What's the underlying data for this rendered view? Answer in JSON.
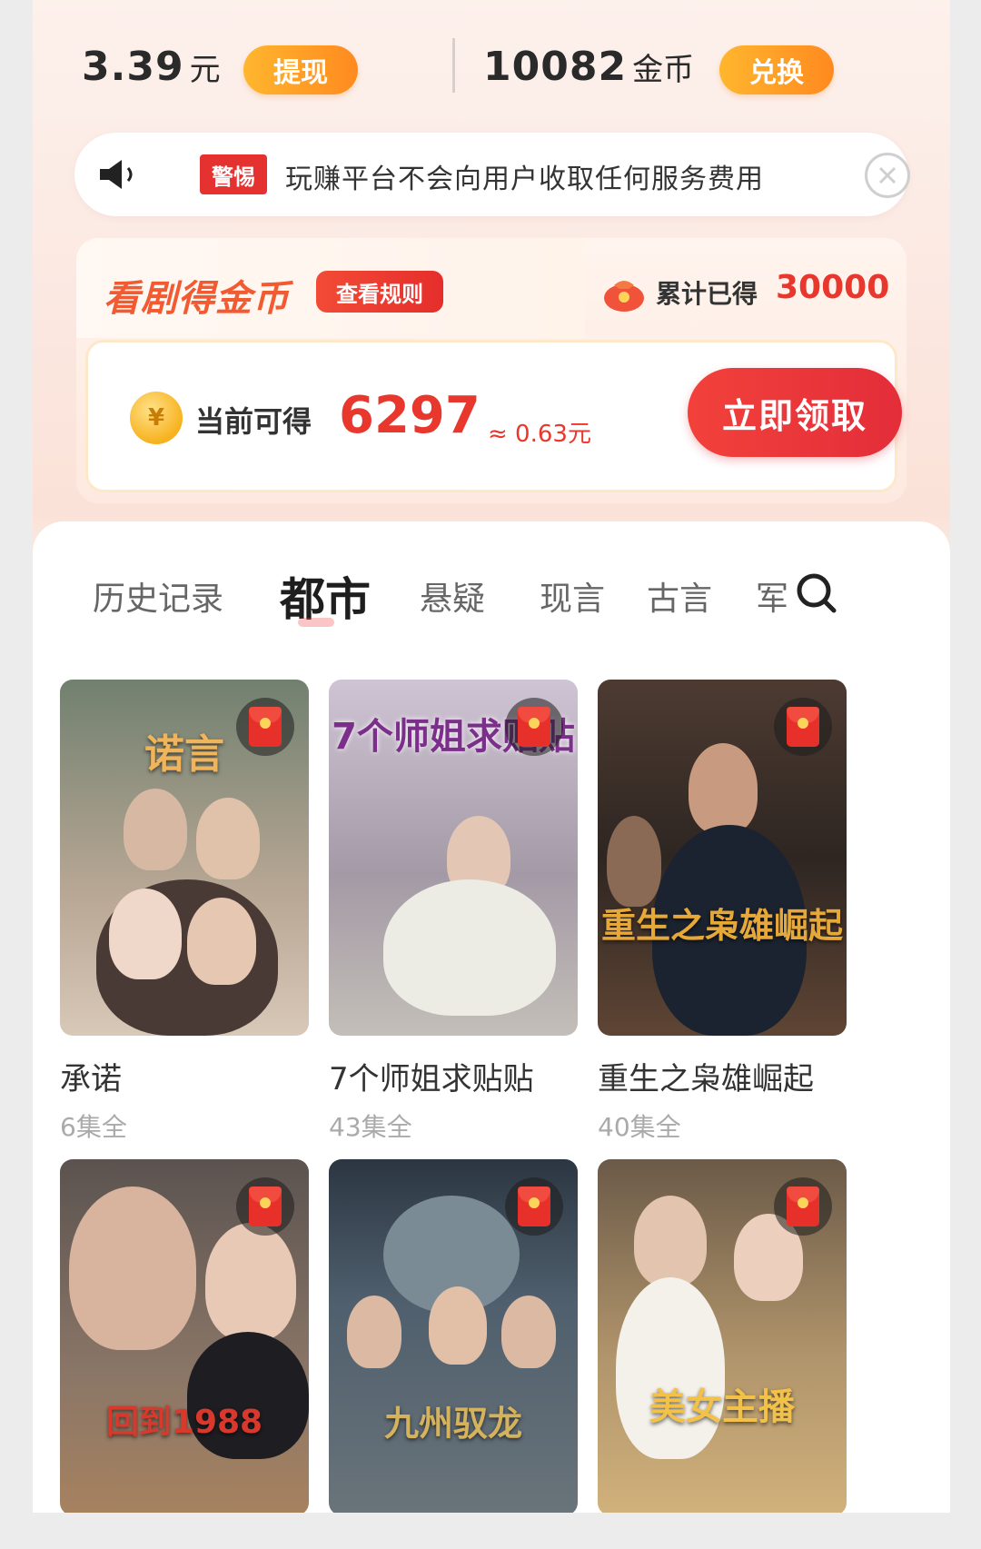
{
  "wallet": {
    "cash_value": "3.39",
    "cash_unit": "元",
    "withdraw_label": "提现",
    "coins_value": "10082",
    "coins_unit": "金币",
    "exchange_label": "兑换"
  },
  "notice": {
    "tag": "警惕",
    "text": "玩赚平台不会向用户收取任何服务费用"
  },
  "earn": {
    "title": "看剧得金币",
    "rules_label": "查看规则",
    "total_label": "累计已得",
    "total_value": "30000",
    "coin_symbol": "¥",
    "current_label": "当前可得",
    "current_value": "6297",
    "current_approx": "≈ 0.63元",
    "claim_label": "立即领取"
  },
  "tabs": [
    {
      "label": "历史记录",
      "active": false
    },
    {
      "label": "都市",
      "active": true
    },
    {
      "label": "悬疑",
      "active": false
    },
    {
      "label": "现言",
      "active": false
    },
    {
      "label": "古言",
      "active": false
    },
    {
      "label": "军",
      "active": false
    }
  ],
  "dramas": [
    {
      "title": "承诺",
      "episodes": "6集全",
      "poster_text": "诺言",
      "bg1": "#6d7b6b",
      "bg2": "#c9b7a7"
    },
    {
      "title": "7个师姐求贴贴",
      "episodes": "43集全",
      "poster_text": "7个师姐求贴贴",
      "bg1": "#bfb4c4",
      "bg2": "#8f8692"
    },
    {
      "title": "重生之枭雄崛起",
      "episodes": "40集全",
      "poster_text": "重生之枭雄崛起",
      "bg1": "#3b2e28",
      "bg2": "#7a5a44"
    },
    {
      "title": "",
      "episodes": "",
      "poster_text": "回到1988",
      "bg1": "#5d5550",
      "bg2": "#8f6f5b"
    },
    {
      "title": "",
      "episodes": "",
      "poster_text": "九州驭龙",
      "bg1": "#27313d",
      "bg2": "#5a6c78"
    },
    {
      "title": "",
      "episodes": "",
      "poster_text": "美女主播",
      "bg1": "#5a4a3c",
      "bg2": "#c4a46a"
    }
  ],
  "colors": {
    "accent_red": "#e8372c",
    "accent_orange": "#ff9a22"
  }
}
